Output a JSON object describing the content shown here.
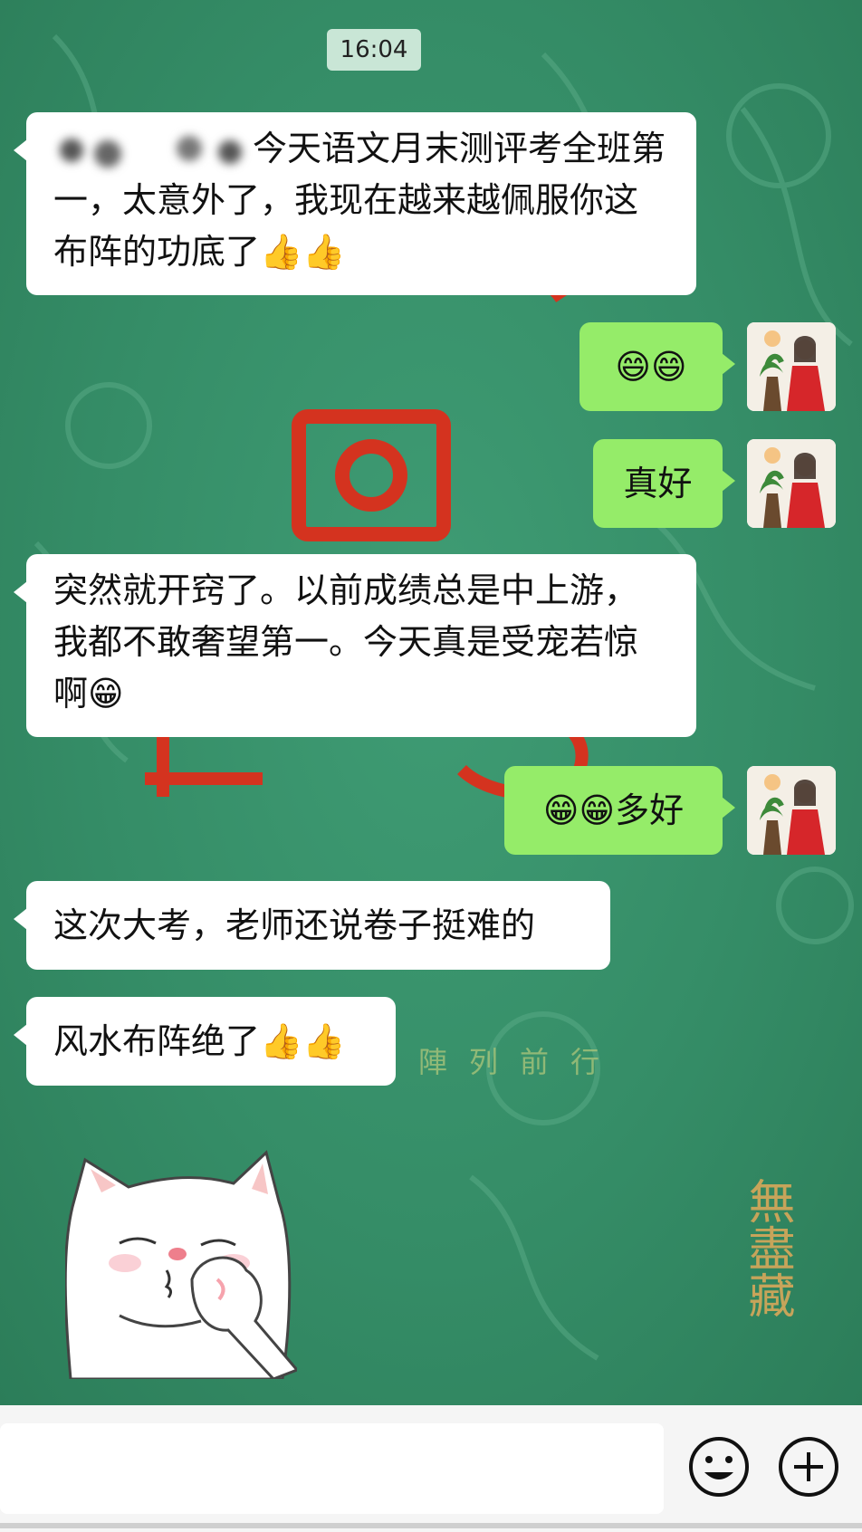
{
  "status": {
    "time": "16:04"
  },
  "messages": [
    {
      "side": "left",
      "text": "今天语文月末测评考全班第一，太意外了，我现在越来越佩服你这布阵的功底了👍👍",
      "redacted_prefix": true
    },
    {
      "side": "right",
      "text": "😄😄"
    },
    {
      "side": "right",
      "text": "真好"
    },
    {
      "side": "left",
      "text": "突然就开窍了。以前成绩总是中上游，我都不敢奢望第一。今天真是受宠若惊啊😁"
    },
    {
      "side": "right",
      "text": "😁😁多好"
    },
    {
      "side": "left",
      "text": "这次大考，老师还说卷子挺难的"
    },
    {
      "side": "left",
      "text": "风水布阵绝了👍👍"
    }
  ],
  "background": {
    "caption": "陣列前行",
    "signature": "無盡藏"
  },
  "input": {
    "emoji_icon": "smiley-icon",
    "plus_icon": "plus-icon"
  },
  "colors": {
    "chat_bg": "#358d67",
    "sent_bubble": "#95ec69",
    "recv_bubble": "#ffffff",
    "time_badge": "#c9e6d6"
  }
}
